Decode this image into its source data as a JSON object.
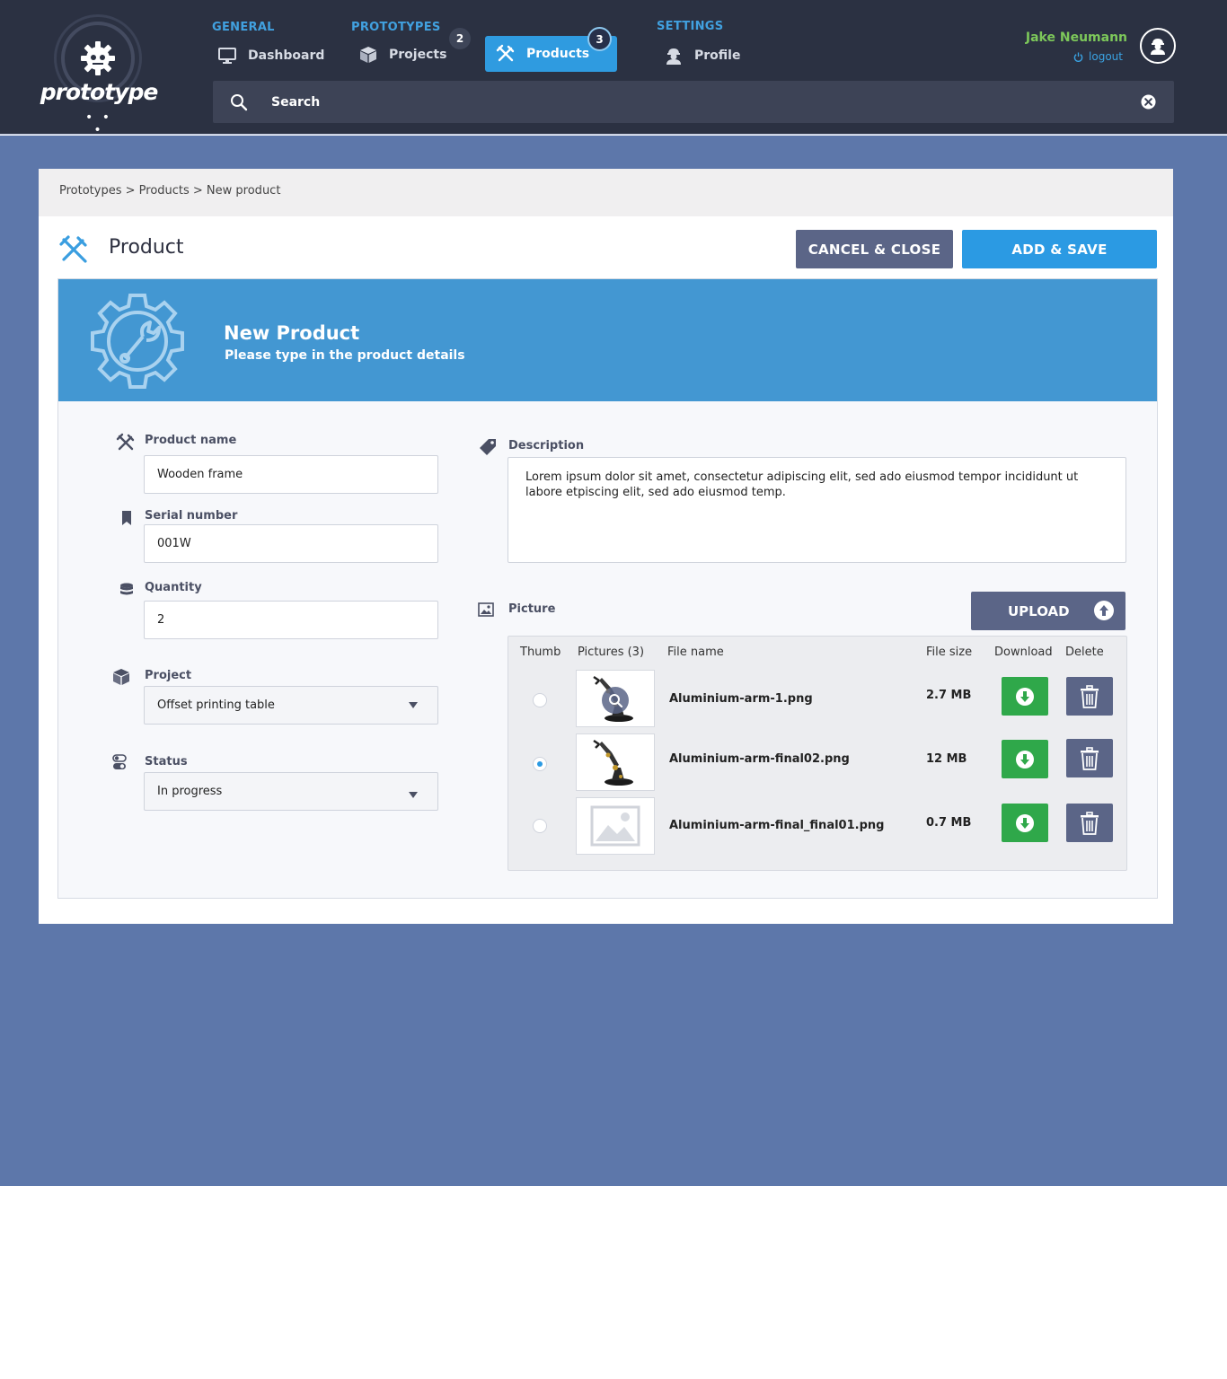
{
  "app": {
    "logo_text": "prototype",
    "logo_dots": "• • •"
  },
  "nav": {
    "groups": [
      {
        "label": "GENERAL"
      },
      {
        "label": "PROTOTYPES"
      },
      {
        "label": "SETTINGS"
      }
    ],
    "items": [
      {
        "label": "Dashboard",
        "icon": "monitor-icon"
      },
      {
        "label": "Projects",
        "icon": "box-icon",
        "badge": "2"
      },
      {
        "label": "Products",
        "icon": "tools-icon",
        "badge": "3",
        "active": true
      },
      {
        "label": "Profile",
        "icon": "worker-icon"
      }
    ]
  },
  "user": {
    "name": "Jake Neumann",
    "logout_label": "logout",
    "avatar_icon": "worker-avatar-icon"
  },
  "search": {
    "placeholder": "Search"
  },
  "breadcrumb": "Prototypes > Products > New product",
  "page": {
    "title": "Product",
    "cancel_label": "CANCEL & CLOSE",
    "save_label": "ADD & SAVE"
  },
  "hero": {
    "title": "New Product",
    "subtitle": "Please type in the product details"
  },
  "form": {
    "product_name": {
      "label": "Product name",
      "value": "Wooden frame"
    },
    "serial_number": {
      "label": "Serial number",
      "value": "001W"
    },
    "quantity": {
      "label": "Quantity",
      "value": "2"
    },
    "project": {
      "label": "Project",
      "value": "Offset printing table"
    },
    "status": {
      "label": "Status",
      "value": "In progress"
    },
    "description": {
      "label": "Description",
      "value": "Lorem ipsum dolor sit amet, consectetur adipiscing elit, sed ado eiusmod tempor incididunt ut labore etpiscing elit, sed ado eiusmod temp."
    }
  },
  "pictures": {
    "label": "Picture",
    "upload_label": "UPLOAD",
    "columns": {
      "thumb": "Thumb",
      "pictures": "Pictures (3)",
      "file_name": "File name",
      "file_size": "File size",
      "download": "Download",
      "delete": "Delete"
    },
    "rows": [
      {
        "file_name": "Aluminium-arm-1.png",
        "file_size": "2.7 MB",
        "selected": false,
        "thumb": "robot-arm-image"
      },
      {
        "file_name": "Aluminium-arm-final02.png",
        "file_size": "12 MB",
        "selected": true,
        "thumb": "robot-arm-image"
      },
      {
        "file_name": "Aluminium-arm-final_final01.png",
        "file_size": "0.7 MB",
        "selected": false,
        "thumb": "image-placeholder-icon"
      }
    ]
  },
  "colors": {
    "header_bg": "#2b3142",
    "accent": "#2b9ae3",
    "page_bg": "#5d77aa",
    "success": "#2fa84a",
    "secondary": "#5b6587",
    "username": "#7dc85a"
  }
}
